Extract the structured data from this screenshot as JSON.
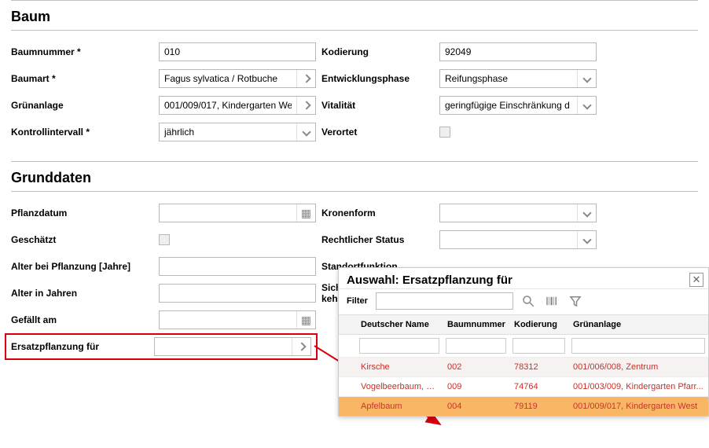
{
  "baum": {
    "title": "Baum",
    "baumnummer": {
      "label": "Baumnummer *",
      "value": "010"
    },
    "baumart": {
      "label": "Baumart *",
      "value": "Fagus sylvatica / Rotbuche"
    },
    "gruenanlage": {
      "label": "Grünanlage",
      "value": "001/009/017, Kindergarten We"
    },
    "kontrollintervall": {
      "label": "Kontrollintervall *",
      "value": "jährlich"
    },
    "kodierung": {
      "label": "Kodierung",
      "value": "92049"
    },
    "entwicklungsphase": {
      "label": "Entwicklungsphase",
      "value": "Reifungsphase"
    },
    "vitalitaet": {
      "label": "Vitalität",
      "value": "geringfügige Einschränkung d"
    },
    "verortet": {
      "label": "Verortet"
    }
  },
  "grunddaten": {
    "title": "Grunddaten",
    "pflanzdatum": {
      "label": "Pflanzdatum",
      "value": ""
    },
    "geschaetzt": {
      "label": "Geschätzt"
    },
    "alter_pflanzung": {
      "label": "Alter bei Pflanzung [Jahre]",
      "value": ""
    },
    "alter_jahren": {
      "label": "Alter in Jahren",
      "value": ""
    },
    "gefaellt_am": {
      "label": "Gefällt am",
      "value": ""
    },
    "ersatzpflanzung": {
      "label": "Ersatzpflanzung für",
      "value": ""
    },
    "kronenform": {
      "label": "Kronenform",
      "value": ""
    },
    "rechtlicher_status": {
      "label": "Rechtlicher Status",
      "value": ""
    },
    "standortfunktion": {
      "label": "Standortfunktion"
    },
    "sicherheit_kehr": {
      "label1": "Siche",
      "label2": "kehr"
    }
  },
  "modal": {
    "title": "Auswahl: Ersatzpflanzung für",
    "filter_label": "Filter",
    "filter_value": "",
    "columns": {
      "c0": "",
      "c1": "Deutscher Name",
      "c2": "Baumnummer",
      "c3": "Kodierung",
      "c4": "Grünanlage"
    },
    "rows": [
      {
        "name": "Kirsche",
        "baumnummer": "002",
        "kodierung": "78312",
        "gruenanlage": "001/006/008, Zentrum"
      },
      {
        "name": "Vogelbeerbaum, E...",
        "baumnummer": "009",
        "kodierung": "74764",
        "gruenanlage": "001/003/009, Kindergarten Pfarr..."
      },
      {
        "name": "Apfelbaum",
        "baumnummer": "004",
        "kodierung": "79119",
        "gruenanlage": "001/009/017, Kindergarten West"
      }
    ]
  }
}
